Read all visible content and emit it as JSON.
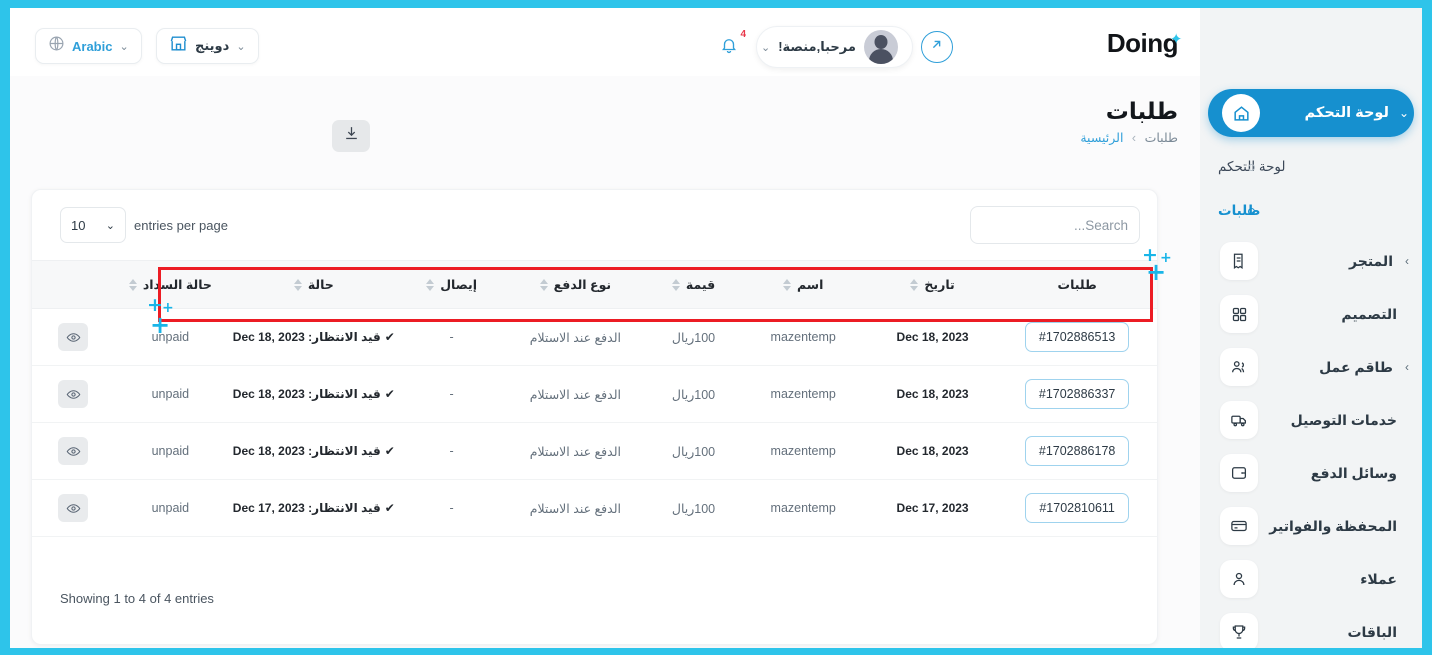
{
  "brand": {
    "logo_text": "Doing",
    "spark": "✦",
    "accent": "#2ec4ea",
    "primary": "#1690cf"
  },
  "topbar": {
    "language_pill": {
      "label": "Arabic",
      "icon": "globe-icon",
      "chevron": "⌄"
    },
    "store_pill": {
      "label": "دوينج",
      "icon": "store-icon",
      "chevron": "⌄"
    },
    "external_link_icon": "arrow-up-right-circle-icon",
    "user": {
      "greeting": "مرحبا,منصة!",
      "chevron": "⌄",
      "avatar": "user-avatar"
    },
    "notifications": {
      "icon": "bell-icon",
      "count": "4",
      "count_color": "#e8374a"
    }
  },
  "sidebar": {
    "active": {
      "label": "لوحة التحكم",
      "icon": "home-icon",
      "chevron": "⌄"
    },
    "subitems": [
      {
        "label": "لوحة التحكم",
        "active": false
      },
      {
        "label": "طلبات",
        "active": true
      }
    ],
    "items": [
      {
        "label": "المتجر",
        "icon": "store-receipt-icon",
        "arrow": "›"
      },
      {
        "label": "التصميم",
        "icon": "grid-icon",
        "arrow": ""
      },
      {
        "label": "طاقم عمل",
        "icon": "users-icon",
        "arrow": "›"
      },
      {
        "label": "خدمات التوصيل",
        "icon": "truck-icon",
        "arrow": ""
      },
      {
        "label": "وسائل الدفع",
        "icon": "wallet-icon",
        "arrow": ""
      },
      {
        "label": "المحفظة والفواتير",
        "icon": "credit-card-icon",
        "arrow": ""
      },
      {
        "label": "عملاء",
        "icon": "person-icon",
        "arrow": ""
      },
      {
        "label": "الباقات",
        "icon": "trophy-icon",
        "arrow": ""
      }
    ]
  },
  "page": {
    "title": "طلبات",
    "breadcrumb": {
      "home": "الرئيسية",
      "separator": "›",
      "current": "طلبات"
    },
    "export_icon": "download-icon"
  },
  "table_controls": {
    "entries_label": "entries per page",
    "entries_value": "10",
    "entries_chevron": "⌄",
    "search_placeholder": "Search...",
    "search_value": ""
  },
  "table": {
    "columns": [
      {
        "label": "طلبات",
        "sortable": false
      },
      {
        "label": "تاريخ",
        "sortable": true
      },
      {
        "label": "اسم",
        "sortable": true
      },
      {
        "label": "قيمة",
        "sortable": true
      },
      {
        "label": "نوع الدفع",
        "sortable": true
      },
      {
        "label": "إيصال",
        "sortable": true
      },
      {
        "label": "حالة",
        "sortable": true
      },
      {
        "label": "حالة السداد",
        "sortable": true
      },
      {
        "label": "",
        "sortable": false
      }
    ],
    "rows": [
      {
        "order": "#1702886513",
        "date": "Dec 18, 2023",
        "name": "mazentemp",
        "value": "100ريال",
        "payment_type": "الدفع عند الاستلام",
        "receipt": "-",
        "status": "قيد الانتظار: Dec 18, 2023",
        "status_check": "✔",
        "payment_status": "unpaid",
        "action_icon": "eye-icon"
      },
      {
        "order": "#1702886337",
        "date": "Dec 18, 2023",
        "name": "mazentemp",
        "value": "100ريال",
        "payment_type": "الدفع عند الاستلام",
        "receipt": "-",
        "status": "قيد الانتظار: Dec 18, 2023",
        "status_check": "✔",
        "payment_status": "unpaid",
        "action_icon": "eye-icon"
      },
      {
        "order": "#1702886178",
        "date": "Dec 18, 2023",
        "name": "mazentemp",
        "value": "100ريال",
        "payment_type": "الدفع عند الاستلام",
        "receipt": "-",
        "status": "قيد الانتظار: Dec 18, 2023",
        "status_check": "✔",
        "payment_status": "unpaid",
        "action_icon": "eye-icon"
      },
      {
        "order": "#1702810611",
        "date": "Dec 17, 2023",
        "name": "mazentemp",
        "value": "100ريال",
        "payment_type": "الدفع عند الاستلام",
        "receipt": "-",
        "status": "قيد الانتظار: Dec 17, 2023",
        "status_check": "✔",
        "payment_status": "unpaid",
        "action_icon": "eye-icon"
      }
    ],
    "footer": "Showing 1 to 4 of 4 entries"
  },
  "annotation": {
    "highlight_color": "#ec1c24",
    "marker_color": "#19b5e8",
    "marker": "+"
  }
}
